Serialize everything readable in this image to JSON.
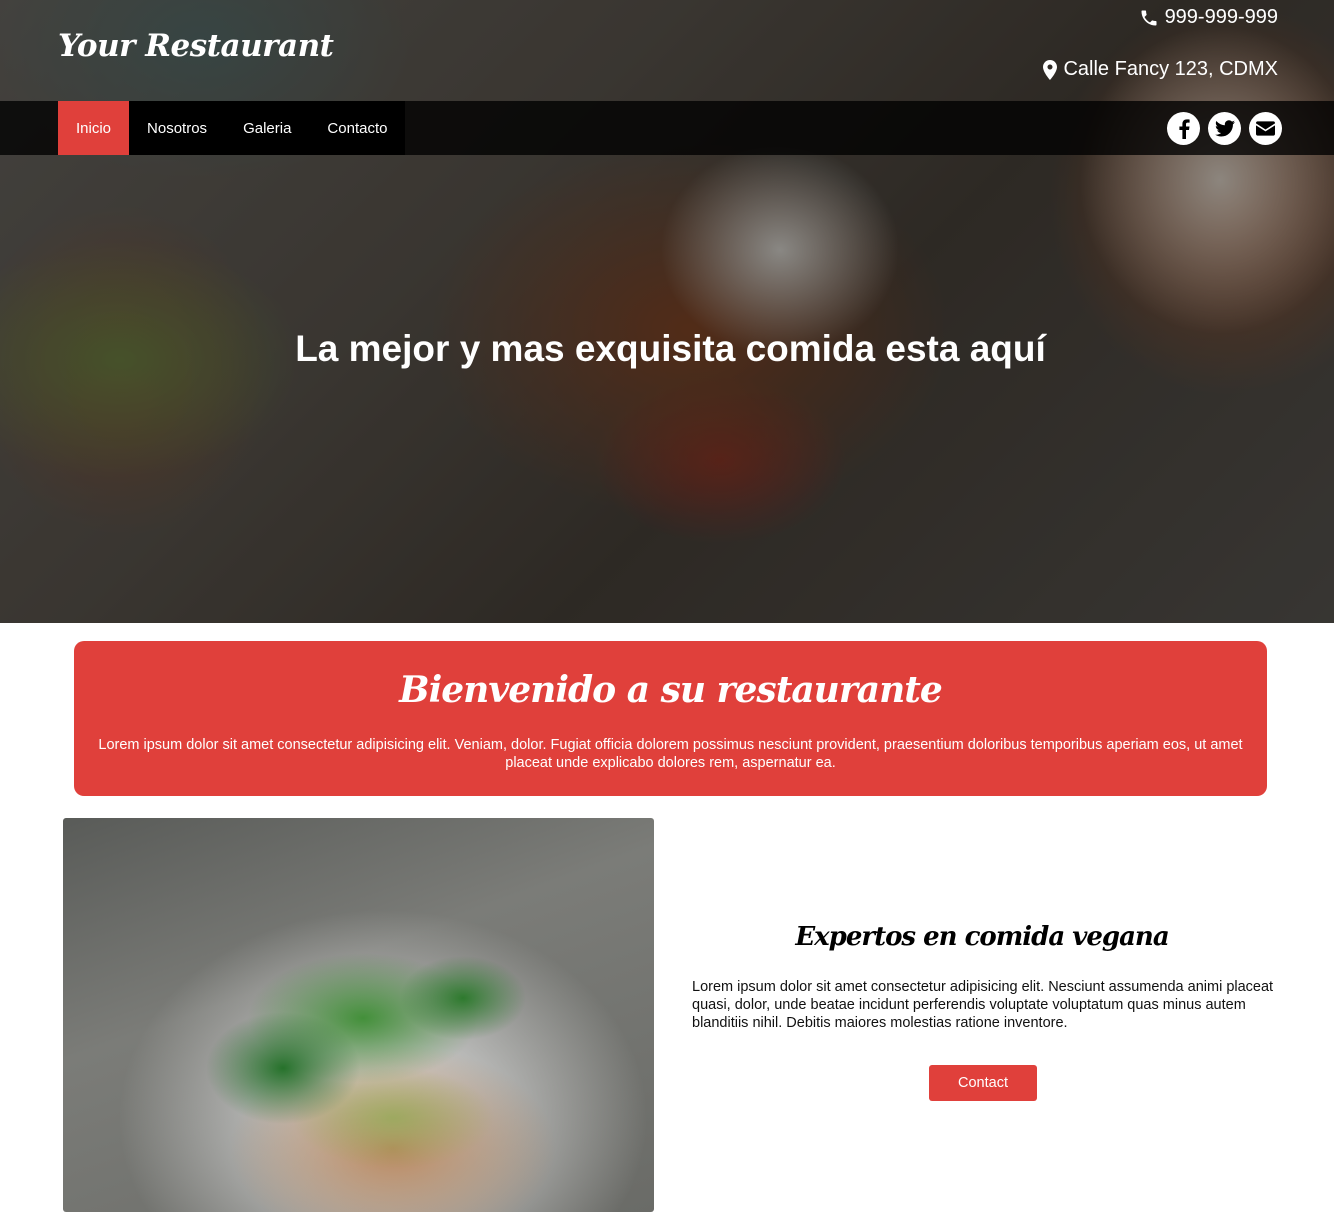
{
  "header": {
    "brand": "Your Restaurant",
    "phone": "999-999-999",
    "address": "Calle Fancy 123, CDMX"
  },
  "nav": {
    "items": [
      {
        "label": "Inicio",
        "active": true
      },
      {
        "label": "Nosotros",
        "active": false
      },
      {
        "label": "Galeria",
        "active": false
      },
      {
        "label": "Contacto",
        "active": false
      }
    ],
    "social": [
      "facebook-icon",
      "twitter-icon",
      "envelope-icon"
    ]
  },
  "hero": {
    "title": "La mejor y mas exquisita comida esta aquí"
  },
  "welcome": {
    "title": "Bienvenido a su restaurante",
    "text": "Lorem ipsum dolor sit amet consectetur adipisicing elit. Veniam, dolor. Fugiat officia dolorem possimus nesciunt provident, praesentium doloribus temporibus aperiam eos, ut amet placeat unde explicabo dolores rem, aspernatur ea."
  },
  "feature": {
    "title": "Expertos en comida vegana",
    "text": "Lorem ipsum dolor sit amet consectetur adipisicing elit. Nesciunt assumenda animi placeat quasi, dolor, unde beatae incidunt perferendis voluptate voluptatum quas minus autem blanditiis nihil. Debitis maiores molestias ratione inventore.",
    "button_label": "Contact"
  },
  "colors": {
    "accent": "#e0403b",
    "nav_bg": "#000000",
    "text": "#111111"
  }
}
